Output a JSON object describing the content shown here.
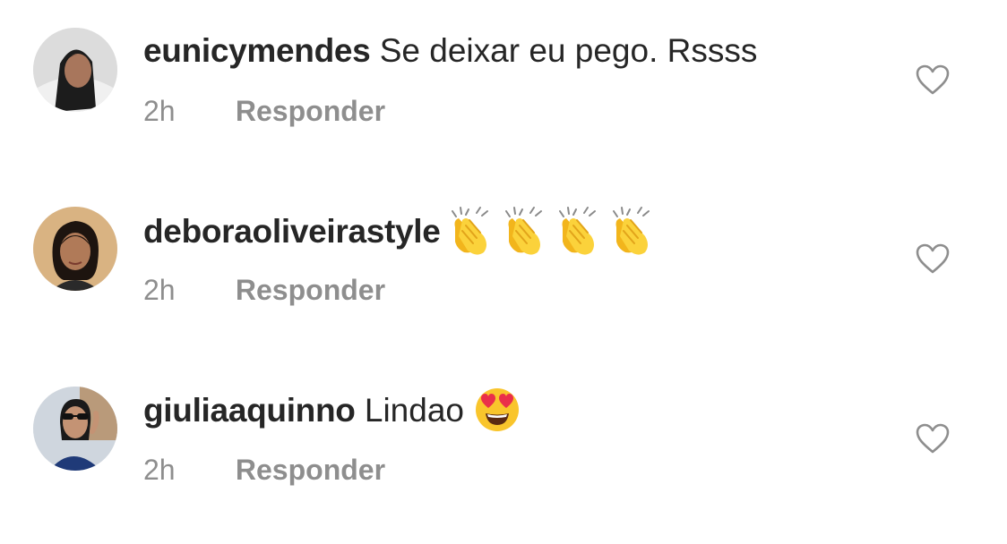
{
  "comments": [
    {
      "username": "eunicymendes",
      "text": "Se deixar eu pego. Rssss",
      "emojis": [],
      "time": "2h",
      "reply_label": "Responder",
      "like_icon": "heart-outline-icon"
    },
    {
      "username": "deboraoliveirastyle",
      "text": "",
      "emojis": [
        "clapping-hands-emoji",
        "clapping-hands-emoji",
        "clapping-hands-emoji",
        "clapping-hands-emoji"
      ],
      "time": "2h",
      "reply_label": "Responder",
      "like_icon": "heart-outline-icon"
    },
    {
      "username": "giuliaaquinno",
      "text": "Lindao",
      "emojis": [
        "heart-eyes-emoji"
      ],
      "time": "2h",
      "reply_label": "Responder",
      "like_icon": "heart-outline-icon"
    }
  ],
  "colors": {
    "username": "#262626",
    "meta": "#8e8e8e",
    "heart_outline": "#8e8e8e",
    "emoji_yellow": "#f9c52c",
    "emoji_heart": "#ea2f4a"
  }
}
